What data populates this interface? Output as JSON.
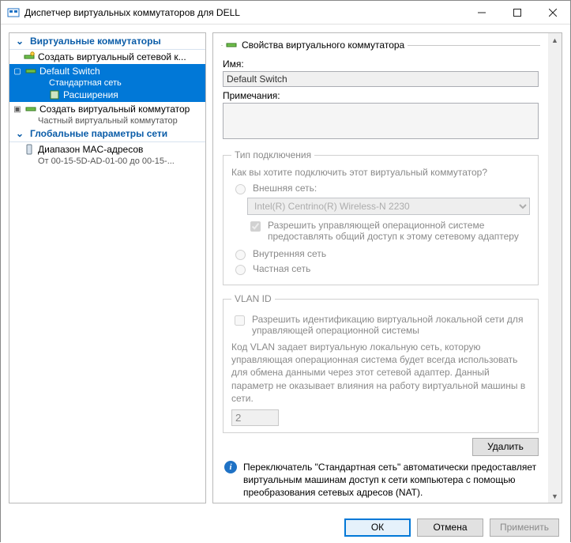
{
  "window": {
    "title": "Диспетчер виртуальных коммутаторов для DELL"
  },
  "left": {
    "section_switches": "Виртуальные коммутаторы",
    "create_switch": "Создать виртуальный сетевой к...",
    "default_switch": "Default Switch",
    "default_switch_sub": "Стандартная сеть",
    "extensions": "Расширения",
    "create_switch2": "Создать виртуальный коммутатор",
    "create_switch2_sub": "Частный виртуальный коммутатор",
    "section_global": "Глобальные параметры сети",
    "mac_range": "Диапазон MAC-адресов",
    "mac_range_sub": "От 00-15-5D-AD-01-00 до 00-15-..."
  },
  "right": {
    "legend": "Свойства виртуального коммутатора",
    "name_label": "Имя:",
    "name_value": "Default Switch",
    "notes_label": "Примечания:",
    "notes_value": "",
    "conn": {
      "legend": "Тип подключения",
      "question": "Как вы хотите подключить этот виртуальный коммутатор?",
      "external": "Внешняя сеть:",
      "adapter": "Intel(R) Centrino(R) Wireless-N 2230",
      "allow_mgmt": "Разрешить управляющей операционной системе предоставлять общий доступ к этому сетевому адаптеру",
      "internal": "Внутренняя сеть",
      "private": "Частная сеть"
    },
    "vlan": {
      "legend": "VLAN ID",
      "enable": "Разрешить идентификацию виртуальной локальной сети для управляющей операционной системы",
      "desc": "Код VLAN задает виртуальную локальную сеть, которую управляющая операционная система будет всегда использовать для обмена данными через этот сетевой адаптер. Данный параметр не оказывает влияния на работу виртуальной машины в сети.",
      "value": "2"
    },
    "delete": "Удалить",
    "info": "Переключатель \"Стандартная сеть\" автоматически предоставляет виртуальным машинам доступ к сети компьютера с помощью преобразования сетевых адресов (NAT)."
  },
  "buttons": {
    "ok": "ОК",
    "cancel": "Отмена",
    "apply": "Применить"
  }
}
